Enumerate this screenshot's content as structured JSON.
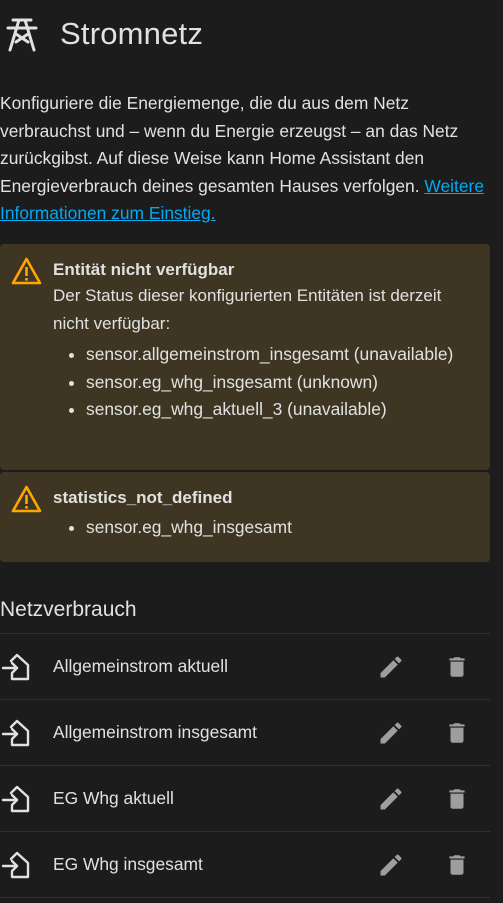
{
  "header": {
    "title": "Stromnetz",
    "icon": "transmission-tower-icon"
  },
  "description": {
    "text": "Konfiguriere die Energiemenge, die du aus dem Netz verbrauchst und – wenn du Energie erzeugst – an das Netz zurückgibst. Auf diese Weise kann Home Assistant den Energieverbrauch deines gesamten Hauses verfolgen. ",
    "link": "Weitere Informationen zum Einstieg."
  },
  "alerts": [
    {
      "title": "Entität nicht verfügbar",
      "text": "Der Status dieser konfigurierten Entitäten ist derzeit nicht verfügbar:",
      "items": [
        "sensor.allgemeinstrom_insgesamt (unavailable)",
        "sensor.eg_whg_insgesamt (unknown)",
        "sensor.eg_whg_aktuell_3 (unavailable)"
      ]
    },
    {
      "title": "statistics_not_defined",
      "items": [
        "sensor.eg_whg_insgesamt"
      ]
    }
  ],
  "consumption": {
    "title": "Netzverbrauch",
    "rows": [
      {
        "label": "Allgemeinstrom aktuell"
      },
      {
        "label": "Allgemeinstrom insgesamt"
      },
      {
        "label": "EG Whg aktuell"
      },
      {
        "label": "EG Whg insgesamt"
      }
    ]
  },
  "colors": {
    "background": "#1c1c1c",
    "warning": "#ffa600",
    "link": "#03a9f4",
    "alert_bg": "#3e3622",
    "icon": "#9e9e9e"
  }
}
